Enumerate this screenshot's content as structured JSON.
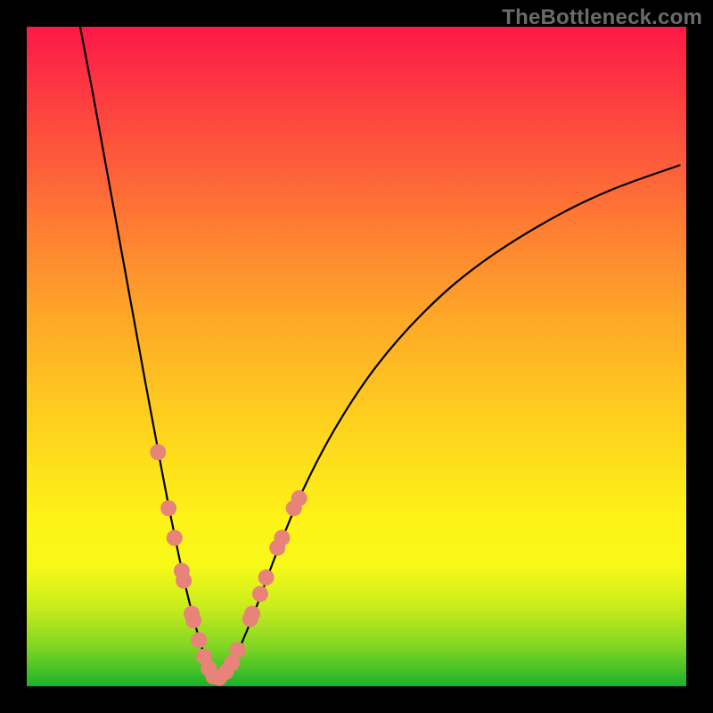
{
  "watermark": "TheBottleneck.com",
  "chart_data": {
    "type": "line",
    "title": "",
    "xlabel": "",
    "ylabel": "",
    "xlim": [
      0,
      100
    ],
    "ylim": [
      0,
      100
    ],
    "grid": false,
    "legend": false,
    "series": [
      {
        "name": "bottleneck-curve-left",
        "stroke": "#000000",
        "stroke_width": 2.2,
        "x": [
          8.1,
          10.0,
          12.0,
          14.0,
          16.0,
          18.0,
          19.5,
          21.0,
          22.5,
          24.0,
          25.5,
          27.0,
          28.4
        ],
        "y": [
          100.0,
          90.0,
          79.0,
          68.0,
          57.0,
          46.0,
          38.0,
          30.0,
          22.5,
          15.5,
          9.5,
          4.5,
          1.2
        ]
      },
      {
        "name": "bottleneck-curve-right",
        "stroke": "#000000",
        "stroke_width": 2.2,
        "x": [
          28.4,
          30.0,
          31.5,
          33.0,
          35.0,
          38.0,
          42.0,
          47.0,
          53.0,
          60.0,
          68.0,
          78.0,
          88.0,
          99.0
        ],
        "y": [
          1.2,
          2.0,
          4.2,
          7.5,
          12.5,
          20.5,
          30.0,
          39.5,
          48.5,
          56.5,
          63.5,
          70.0,
          75.0,
          79.0
        ]
      }
    ],
    "markers": {
      "name": "highlight-dots",
      "fill": "#e78378",
      "radius": 9,
      "points": [
        {
          "x": 19.9,
          "y": 35.5
        },
        {
          "x": 21.5,
          "y": 27.0
        },
        {
          "x": 22.4,
          "y": 22.5
        },
        {
          "x": 23.5,
          "y": 17.5
        },
        {
          "x": 23.8,
          "y": 16.0
        },
        {
          "x": 25.0,
          "y": 11.0
        },
        {
          "x": 25.3,
          "y": 10.0
        },
        {
          "x": 26.1,
          "y": 7.0
        },
        {
          "x": 26.9,
          "y": 4.5
        },
        {
          "x": 27.6,
          "y": 2.7
        },
        {
          "x": 28.3,
          "y": 1.5
        },
        {
          "x": 29.2,
          "y": 1.3
        },
        {
          "x": 30.2,
          "y": 2.2
        },
        {
          "x": 31.1,
          "y": 3.5
        },
        {
          "x": 32.0,
          "y": 5.5
        },
        {
          "x": 33.9,
          "y": 10.2
        },
        {
          "x": 34.2,
          "y": 11.0
        },
        {
          "x": 35.4,
          "y": 14.0
        },
        {
          "x": 36.3,
          "y": 16.5
        },
        {
          "x": 38.0,
          "y": 21.0
        },
        {
          "x": 38.7,
          "y": 22.5
        },
        {
          "x": 40.5,
          "y": 27.0
        },
        {
          "x": 41.3,
          "y": 28.5
        }
      ]
    }
  }
}
